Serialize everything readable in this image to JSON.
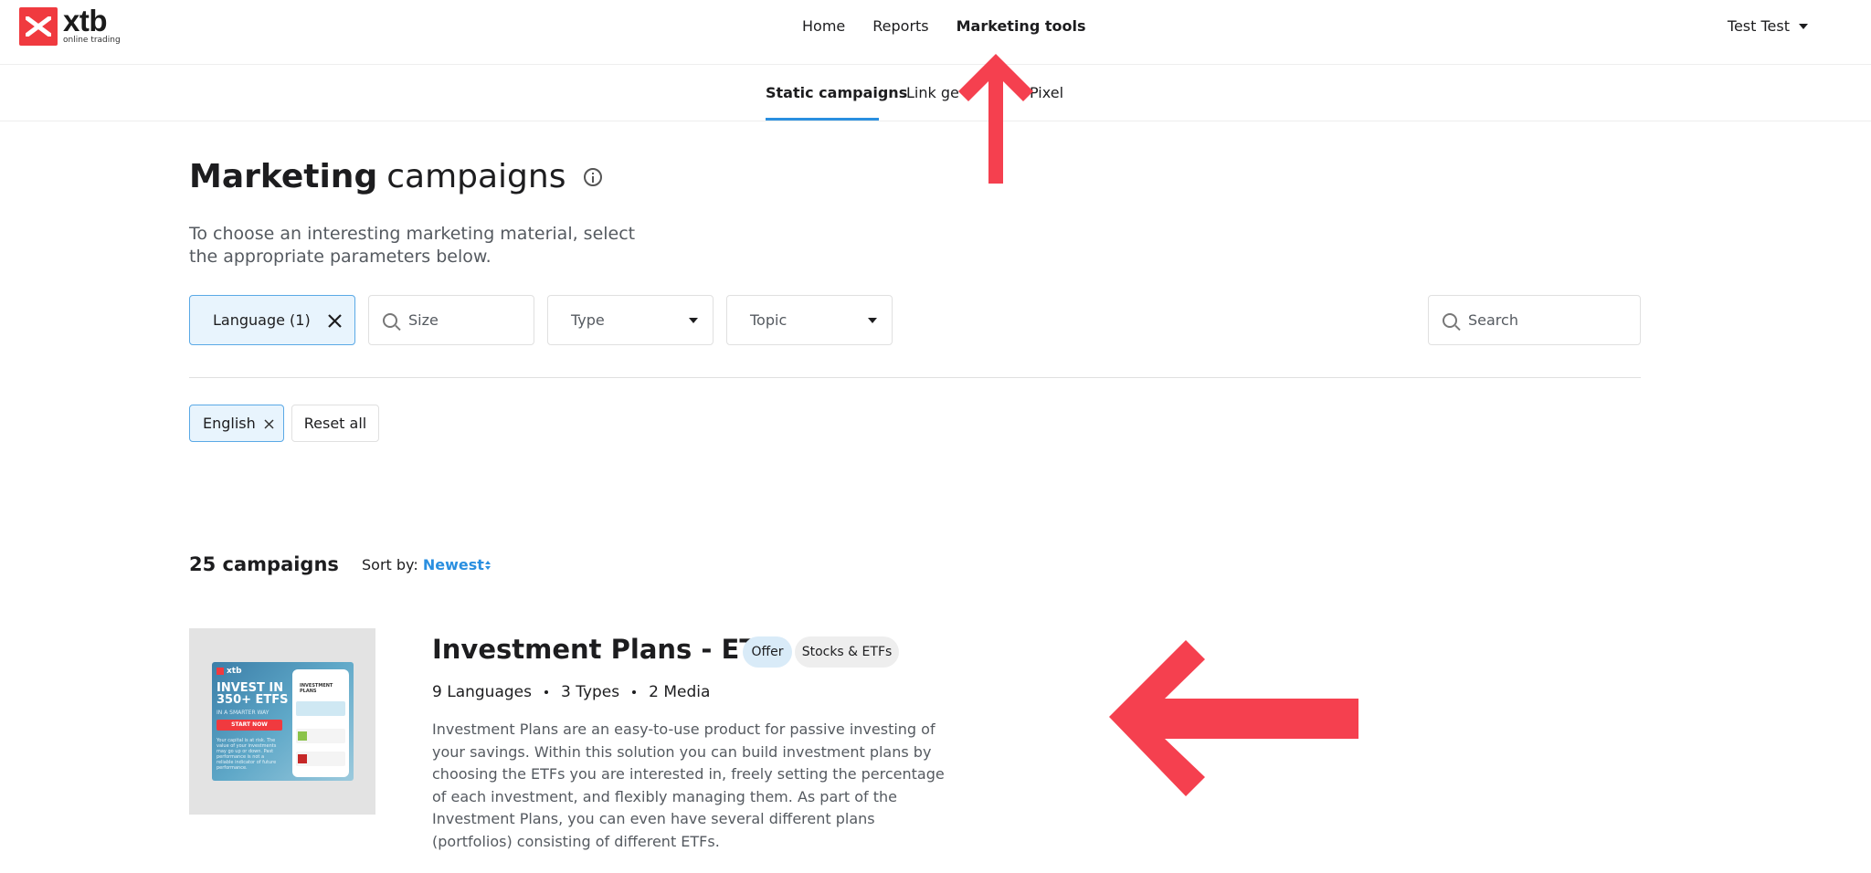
{
  "brand": {
    "name": "xtb",
    "tagline": "online trading",
    "accent": "#f03a3f"
  },
  "nav": {
    "items": [
      "Home",
      "Reports",
      "Marketing tools"
    ],
    "active": "Marketing tools"
  },
  "user": {
    "name": "Test Test"
  },
  "subnav": {
    "tabs": [
      "Static campaigns",
      "Link ge",
      "Pixel"
    ],
    "active": "Static campaigns"
  },
  "page": {
    "title_bold": "Marketing",
    "title_light": "campaigns",
    "subtitle": "To choose an interesting marketing material, select the appropriate parameters below."
  },
  "filters": {
    "language": "Language (1)",
    "size_placeholder": "Size",
    "type": "Type",
    "topic": "Topic",
    "search_placeholder": "Search"
  },
  "active_filters": {
    "chips": [
      "English"
    ],
    "reset": "Reset all"
  },
  "results": {
    "count": "25 campaigns",
    "sort_label": "Sort by:",
    "sort_value": "Newest"
  },
  "campaign": {
    "title": "Investment Plans - ETFs",
    "badges": [
      "Offer",
      "Stocks & ETFs"
    ],
    "meta": [
      "9 Languages",
      "3 Types",
      "2 Media"
    ],
    "description": "Investment Plans are an easy-to-use product for passive investing of your savings. Within this solution you can build investment plans by choosing the ETFs you are interested in, freely setting the percentage of each investment, and flexibly managing them. As part of the Investment Plans, you can even have several different plans (portfolios) consisting of different ETFs.",
    "banner": {
      "logo": "xtb",
      "headline": "INVEST IN 350+ ETFS",
      "subhead": "IN A SMARTER WAY",
      "cta": "START NOW",
      "disclaimer": "Your capital is at risk. The value of your investments may go up or down. Past performance is not a reliable indicator of future performance.",
      "phone_title": "INVESTMENT PLANS"
    }
  },
  "annotations": {
    "arrow_color": "#f5404f"
  }
}
